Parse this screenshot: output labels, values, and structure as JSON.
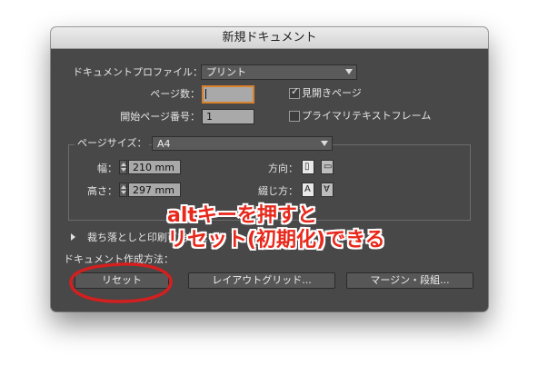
{
  "dialog": {
    "title": "新規ドキュメント",
    "profile_label": "ドキュメントプロファイル：",
    "profile_value": "プリント",
    "pages_label": "ページ数：",
    "pages_value": "",
    "facing_pages_label": "見開きページ",
    "facing_pages_checked": true,
    "start_page_label": "開始ページ番号：",
    "start_page_value": "1",
    "primary_frame_label": "プライマリテキストフレーム",
    "primary_frame_checked": false,
    "page_size_label": "ページサイズ：",
    "page_size_value": "A4",
    "width_label": "幅：",
    "width_value": "210 mm",
    "height_label": "高さ：",
    "height_value": "297 mm",
    "orientation_label": "方向：",
    "binding_label": "綴じ方：",
    "bleed_label": "裁ち落としと印刷可能領域",
    "preview_label_partial": "ドキュメント作成方法：",
    "buttons": {
      "reset": "リセット",
      "layout_grid": "レイアウトグリッド...",
      "margin_columns": "マージン・段組..."
    }
  },
  "annotation": {
    "line1": "altキーを押すと",
    "line2": "リセット(初期化)できる",
    "color": "#e8281b"
  },
  "colors": {
    "dialog_bg": "#484848",
    "focus_ring": "#d9822b",
    "highlight_circle": "#d41f1f"
  }
}
